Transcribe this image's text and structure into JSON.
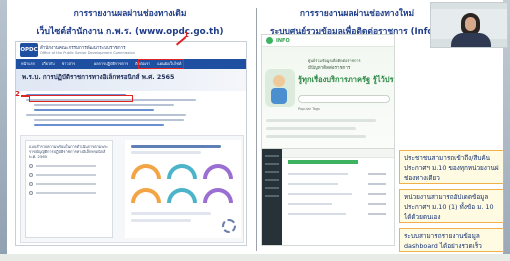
{
  "slide": {
    "left_heading_line1": "การรายงานผลผ่านช่องทางเดิม",
    "left_heading_line2": "เว็บไซต์สำนักงาน ก.พ.ร. (www.opdc.go.th)",
    "right_heading_line1": "การรายงานผลผ่านช่องทางใหม่",
    "right_heading_line2": "ระบบศูนย์รวมข้อมูลเพื่อติดต่อราชการ (Info)"
  },
  "opdc_site": {
    "logo": "OPDC",
    "org_name_line1": "สำนักงานคณะกรรมการพัฒนาระบบราชการ",
    "org_name_line2": "Office of the Public Sector Development Commission",
    "nav_items": [
      "หน้าแรก",
      "เกี่ยวกับ",
      "ข่าวสาร",
      "ผลการปฏิบัติราชการ",
      "ติดต่อเรา",
      "แผนผังเว็บไซต์"
    ],
    "page_title": "พ.ร.บ. การปฏิบัติราชการทางอิเล็กทรอนิกส์ พ.ศ. 2565",
    "card_title": "แบบสำรวจความพร้อมในการดำเนินการตามพระราชบัญญัติการปฏิบัติราชการทางอิเล็กทรอนิกส์ พ.ศ. 2565",
    "marker_1": "1",
    "marker_2": "2"
  },
  "info_site": {
    "logo": "INFO",
    "hero_line1": "ศูนย์รวมข้อมูลเพื่อติดต่อราชการ",
    "hero_line2": "มีปัญหาติดต่อราชการ",
    "hero_line3": "รู้ทุกเรื่องบริการภาครัฐ รู้ไว้ประชาชน",
    "tag_label": "Popular Tags"
  },
  "notes": {
    "note1_line1": "ประชาชนสามารถเข้าถึง/สืบค้น",
    "note1_line2": "ประกาศฯ ม.10 ของทุกหน่วยงานผ่าน",
    "note1_line3": "ช่องทางเดียว",
    "note2_line1": "หน่วยงานสามารถอัปเดตข้อมูล",
    "note2_line2": "ประกาศฯ ม.10 (1) ทั้งข้อ ม. 10",
    "note2_line3": "ได้ด้วยตนเอง",
    "note3_line1": "ระบบสามารถรายงานข้อมูล",
    "note3_line2": "dashboard ได้อย่างรวดเร็ว"
  }
}
